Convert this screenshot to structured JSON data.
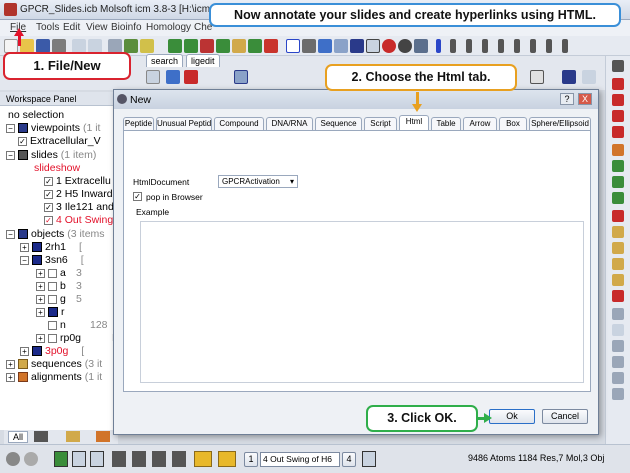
{
  "window": {
    "title": "GPCR_Slides.icb Molsoft icm 3.8-3  [H:\\icmd\\man\\GPCR"
  },
  "menu": [
    "File",
    "Tools",
    "Edit",
    "View",
    "Bioinfo",
    "Homology",
    "Che"
  ],
  "top_tabs": [
    "search",
    "ligedit"
  ],
  "workspace": {
    "header": "Workspace Panel",
    "no_selection": "no selection",
    "viewpoints": {
      "label": "viewpoints",
      "count": "(1 it"
    },
    "viewpoint_item": "Extracellular_V",
    "slides": {
      "label": "slides",
      "count": "(1 item)"
    },
    "slideshow": "slideshow",
    "slide_items": [
      "1 Extracellu",
      "2 H5 Inward",
      "3 Ile121 and",
      "4 Out Swing"
    ],
    "objects": {
      "label": "objects",
      "count": "(3 items"
    },
    "obj_2rh1": {
      "label": "2rh1",
      "note": "["
    },
    "obj_3sn6": {
      "label": "3sn6",
      "note": "["
    },
    "chains": [
      {
        "label": "a",
        "val": "3"
      },
      {
        "label": "b",
        "val": "3"
      },
      {
        "label": "g",
        "val": "5"
      },
      {
        "label": "r",
        "val": ""
      },
      {
        "label": "n",
        "val": "128"
      },
      {
        "label": "rp0g",
        "val": "H"
      }
    ],
    "obj_3p0g": {
      "label": "3p0g",
      "note": "["
    },
    "sequences": {
      "label": "sequences",
      "count": "(3 it"
    },
    "alignments": {
      "label": "alignments",
      "count": "(1 it"
    },
    "bottom_tab": "All"
  },
  "dialog": {
    "title": "New",
    "help": "?",
    "close": "X",
    "tabs": [
      "Peptide",
      "Unusual Peptide",
      "Compound",
      "DNA/RNA",
      "Sequence",
      "Script",
      "Html",
      "Table",
      "Arrow",
      "Box",
      "Sphere/Ellipsoid"
    ],
    "active_tab": "Html",
    "html_document_label": "HtmlDocument",
    "html_document_value": "GPCRActivation",
    "popup_label": "pop in Browser",
    "popup_checked": "✓",
    "example_label": "Example",
    "ok": "Ok",
    "cancel": "Cancel"
  },
  "statusbar": {
    "page": "1",
    "slide_select": "4 Out Swing of H6",
    "slide_num": "4",
    "status": "9486 Atoms 1184 Res,7 Mol,3 Obj"
  },
  "callouts": {
    "banner": "Now annotate your slides and create hyperlinks using HTML.",
    "step1": "1. File/New",
    "step2": "2. Choose the Html tab.",
    "step3": "3. Click OK."
  },
  "colors": {
    "banner_border": "#3a8fd8",
    "step1_border": "#d9232f",
    "step2_border": "#e8a020",
    "step3_border": "#2fae4a",
    "arrow_red": "#e3122b"
  }
}
